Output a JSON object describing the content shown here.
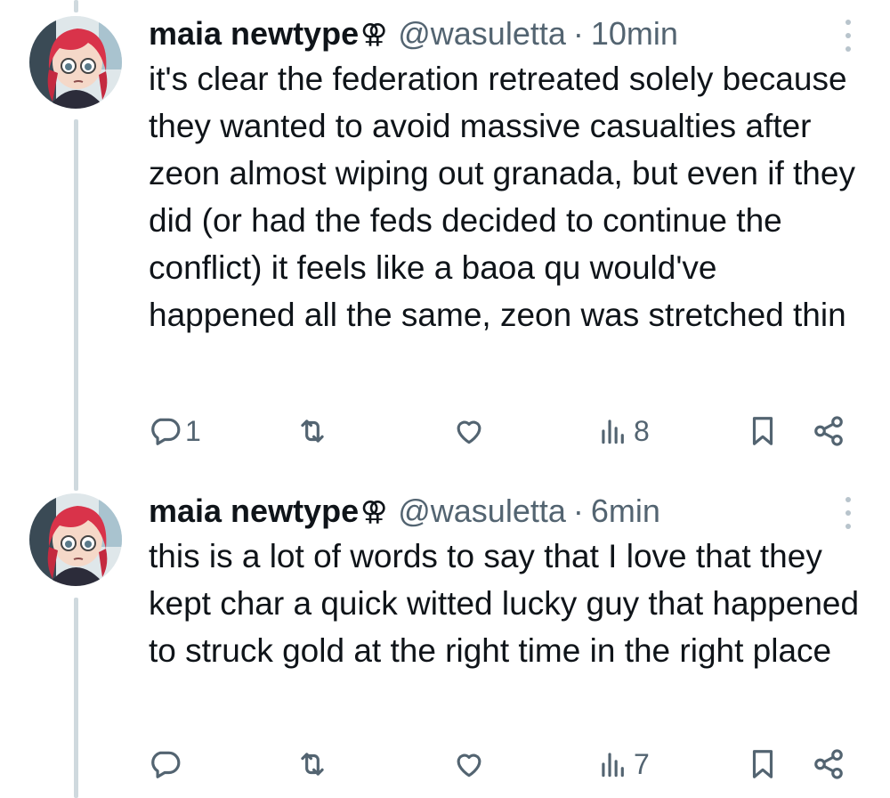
{
  "tweets": [
    {
      "author_name": "maia newtype",
      "badge": "⚢",
      "handle": "@wasuletta",
      "separator": "·",
      "time": "10min",
      "text": "it's clear the federation retreated solely because they wanted to avoid massive casualties after zeon almost wiping out granada, but even if they did (or had the feds decided to continue the conflict) it feels like a baoa qu would've happened all the same, zeon was stretched thin",
      "reply_count": "1",
      "view_count": "8"
    },
    {
      "author_name": "maia newtype",
      "badge": "⚢",
      "handle": "@wasuletta",
      "separator": "·",
      "time": "6min",
      "text": "this is a lot of words to say that I love that they kept char a quick witted lucky guy that happened to struck gold at the right time in the right place",
      "reply_count": "",
      "view_count": "7"
    }
  ],
  "icons": {
    "reply": "reply-icon",
    "retweet": "retweet-icon",
    "like": "heart-icon",
    "views": "views-icon",
    "bookmark": "bookmark-icon",
    "share": "share-icon",
    "more": "more-icon"
  },
  "colors": {
    "text": "#0f1419",
    "secondary": "#536471",
    "thread_line": "#cfd9de"
  }
}
